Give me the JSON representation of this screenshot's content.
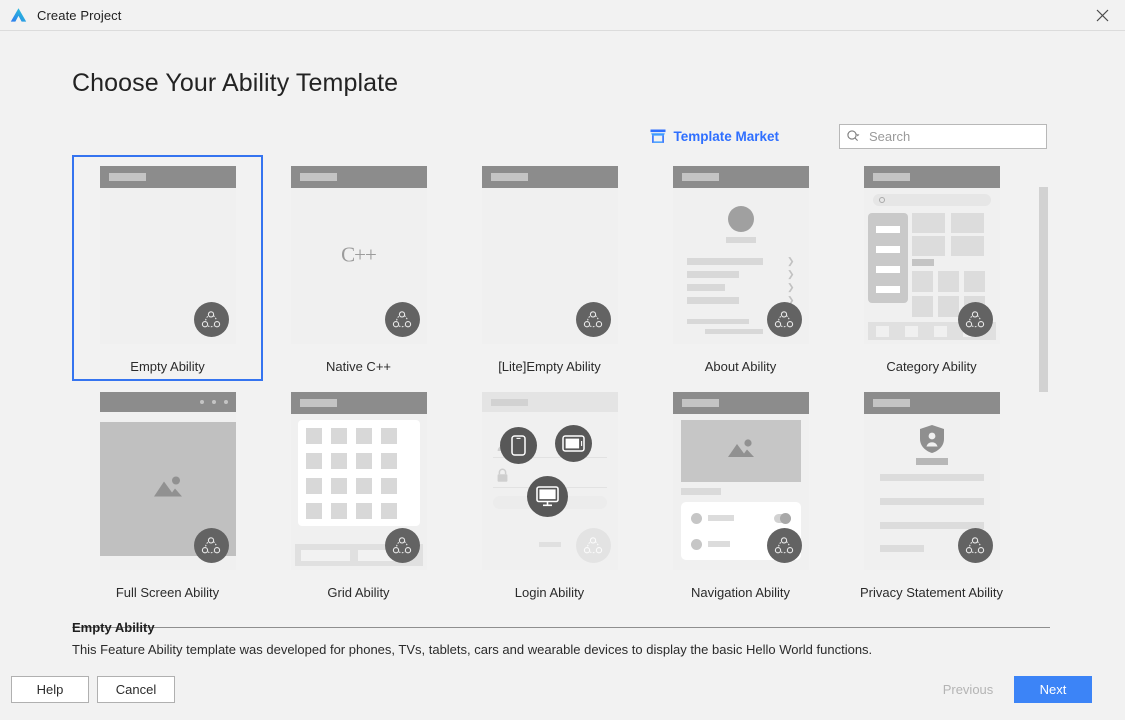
{
  "window": {
    "title": "Create Project",
    "logo_icon": "deveco-logo-icon",
    "close_icon": "close-icon"
  },
  "header": {
    "page_title": "Choose Your Ability Template"
  },
  "toolbar": {
    "template_market_label": "Template Market",
    "template_market_icon": "shop-icon",
    "template_market_color": "#2f6fff",
    "search_icon": "search-dropdown-icon",
    "search_placeholder": "Search",
    "search_value": ""
  },
  "templates": [
    {
      "label": "Empty Ability",
      "kind": "blank",
      "selected": true,
      "badge": "distributed-icon"
    },
    {
      "label": "Native C++",
      "kind": "cpp",
      "selected": false,
      "badge": "distributed-icon",
      "mark": "C++"
    },
    {
      "label": "[Lite]Empty Ability",
      "kind": "blank",
      "selected": false,
      "badge": "distributed-icon"
    },
    {
      "label": "About Ability",
      "kind": "about",
      "selected": false,
      "badge": "distributed-icon"
    },
    {
      "label": "Category Ability",
      "kind": "category",
      "selected": false,
      "badge": "distributed-icon"
    },
    {
      "label": "Full Screen Ability",
      "kind": "fullscreen",
      "selected": false,
      "badge": "distributed-icon"
    },
    {
      "label": "Grid Ability",
      "kind": "grid",
      "selected": false,
      "badge": "distributed-icon"
    },
    {
      "label": "Login Ability",
      "kind": "login",
      "selected": false,
      "badge": "distributed-icon-faded"
    },
    {
      "label": "Navigation Ability",
      "kind": "navigation",
      "selected": false,
      "badge": "distributed-icon"
    },
    {
      "label": "Privacy Statement Ability",
      "kind": "privacy",
      "selected": false,
      "badge": "distributed-icon"
    }
  ],
  "description": {
    "title": "Empty Ability",
    "body": "This Feature Ability template was developed for phones, TVs, tablets, cars and wearable devices to display the basic Hello World functions."
  },
  "footer": {
    "help_label": "Help",
    "cancel_label": "Cancel",
    "previous_label": "Previous",
    "previous_disabled": true,
    "next_label": "Next",
    "next_color": "#3c84f7"
  },
  "scrollbar": {
    "thumb_color": "#d2d2d2"
  }
}
